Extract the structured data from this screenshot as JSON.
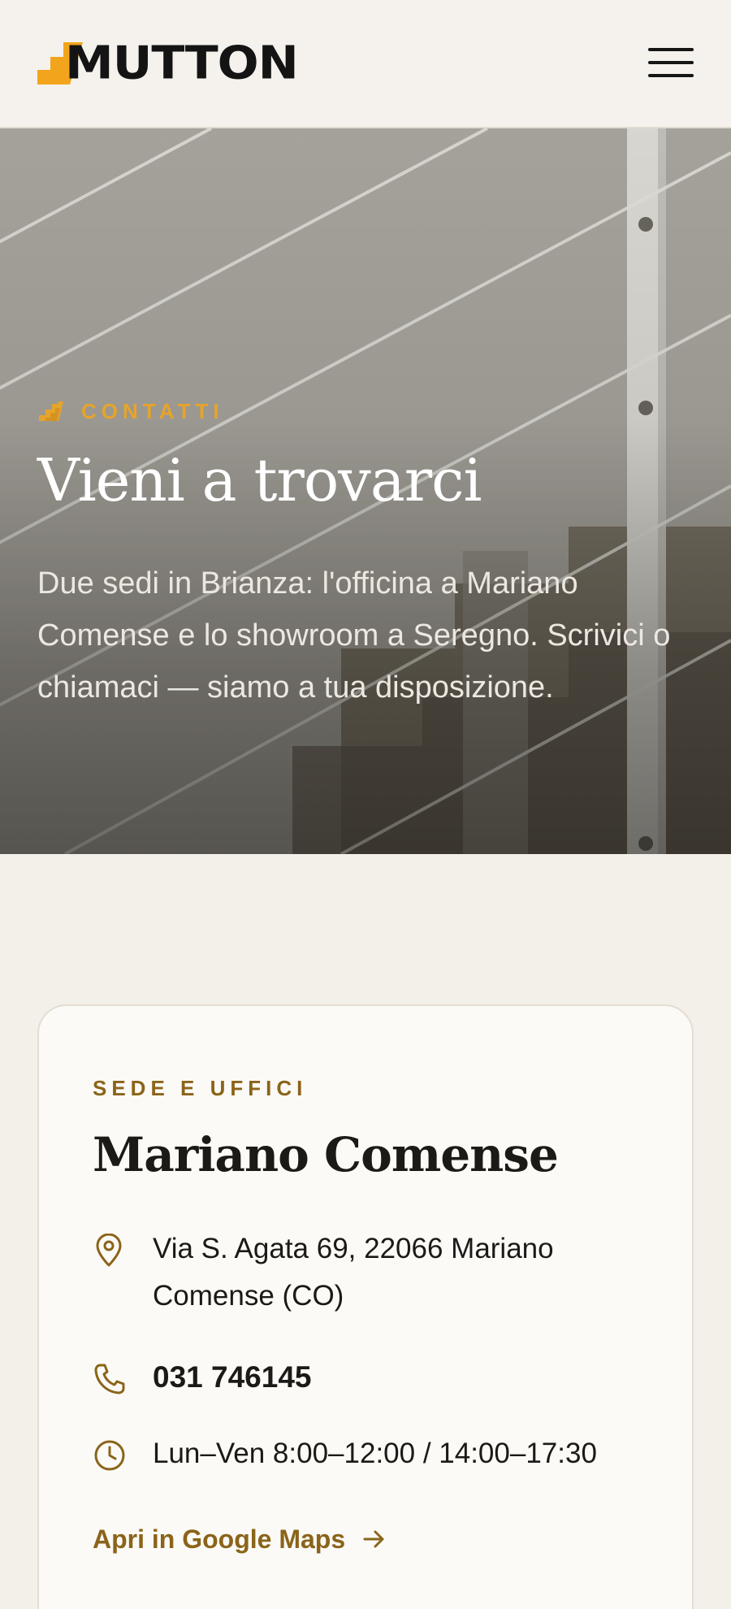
{
  "header": {
    "logo_text": "MUTTON",
    "logo_alt": "Mutton logo",
    "menu_icon": "hamburger-menu-icon",
    "colors": {
      "logo_mark": "#f2a51c",
      "logo_text": "#141414"
    }
  },
  "hero": {
    "eyebrow_icon": "stairs-icon",
    "eyebrow": "CONTATTI",
    "title": "Vieni a trovarci",
    "description": "Due sedi in Brianza: l'officina a Mariano Comense e lo showroom a Seregno. Scrivici o chiamaci — siamo a tua disposizione.",
    "colors": {
      "eyebrow": "#e6a42b",
      "title": "#ffffff"
    }
  },
  "location_card": {
    "eyebrow": "SEDE E UFFICI",
    "title": "Mariano Comense",
    "address_icon": "map-pin-icon",
    "address": "Via S. Agata 69, 22066 Mariano Comense (CO)",
    "phone_icon": "phone-icon",
    "phone": "031 746145",
    "hours_icon": "clock-icon",
    "hours": "Lun–Ven 8:00–12:00 / 14:00–17:30",
    "maps_link": "Apri in Google Maps",
    "maps_link_icon": "arrow-right-icon",
    "colors": {
      "accent": "#8a6419"
    }
  }
}
